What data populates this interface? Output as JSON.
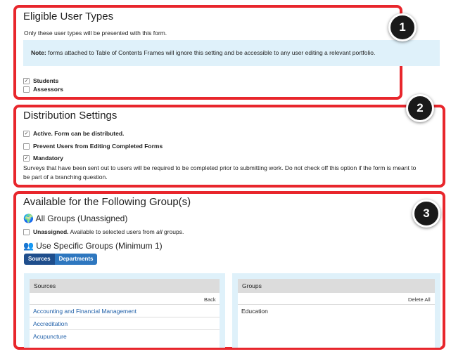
{
  "eligible": {
    "title": "Eligible User Types",
    "description": "Only these user types will be presented with this form.",
    "note_label": "Note:",
    "note_text": " forms attached to Table of Contents Frames will ignore this setting and be accessible to any user editing a relevant portfolio.",
    "options": [
      {
        "label": "Students",
        "checked": true
      },
      {
        "label": "Assessors",
        "checked": false
      }
    ],
    "badge": "1"
  },
  "distribution": {
    "title": "Distribution Settings",
    "options": [
      {
        "label": "Active. Form can be distributed.",
        "checked": true
      },
      {
        "label": "Prevent Users from Editing Completed Forms",
        "checked": false
      },
      {
        "label": "Mandatory",
        "checked": true
      }
    ],
    "mandatory_help_line1": "Surveys that have been sent out to users will be required to be completed prior to submitting work. Do not check off this option if the form is meant to",
    "mandatory_help_line2": "be part of a branching question.",
    "badge": "2"
  },
  "groups": {
    "title": "Available for the Following Group(s)",
    "all_groups_title": "All Groups (Unassigned)",
    "unassigned_bold": "Unassigned.",
    "unassigned_text_pre": " Available to selected users from ",
    "unassigned_text_em": "all",
    "unassigned_text_post": " groups.",
    "unassigned_checked": false,
    "specific_title": "Use Specific Groups (Minimum 1)",
    "crumbs": [
      "Sources",
      "Departments"
    ],
    "sources_header": "Sources",
    "back_label": "Back",
    "sources_items": [
      "Accounting and Financial Management",
      "Accreditation",
      "Acupuncture"
    ],
    "groups_header": "Groups",
    "delete_all_label": "Delete All",
    "groups_items": [
      "Education"
    ],
    "badge": "3"
  },
  "colors": {
    "accent_red": "#e8262c",
    "link_blue": "#1f5fa8",
    "note_bg": "#dff1fa",
    "pill_dark": "#1f4e8c",
    "pill_light": "#2e77bf"
  }
}
